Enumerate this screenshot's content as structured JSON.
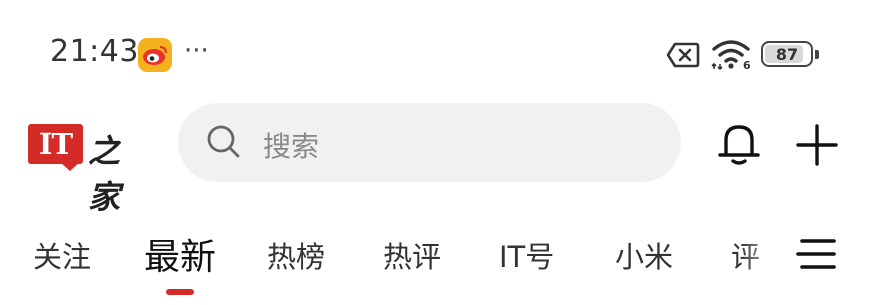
{
  "status_bar": {
    "time": "21:43",
    "more_indicator": "···",
    "battery_level": "87",
    "battery_fraction": 0.87,
    "icons": [
      "weibo-icon",
      "sim-off-icon",
      "wifi-6-icon",
      "battery-icon"
    ]
  },
  "header": {
    "logo_mark": "IT",
    "logo_text": "之家",
    "search_placeholder": "搜索",
    "icons": [
      "search-icon",
      "bell-icon",
      "plus-icon"
    ]
  },
  "tabs": [
    {
      "label": "关注",
      "active": false
    },
    {
      "label": "最新",
      "active": true
    },
    {
      "label": "热榜",
      "active": false
    },
    {
      "label": "热评",
      "active": false
    },
    {
      "label": "IT号",
      "active": false
    },
    {
      "label": "小米",
      "active": false
    },
    {
      "label": "评",
      "active": false
    }
  ],
  "colors": {
    "brand_red": "#d42b27",
    "search_bg": "#f1f1f1",
    "weibo_yellow": "#f6b11f"
  }
}
